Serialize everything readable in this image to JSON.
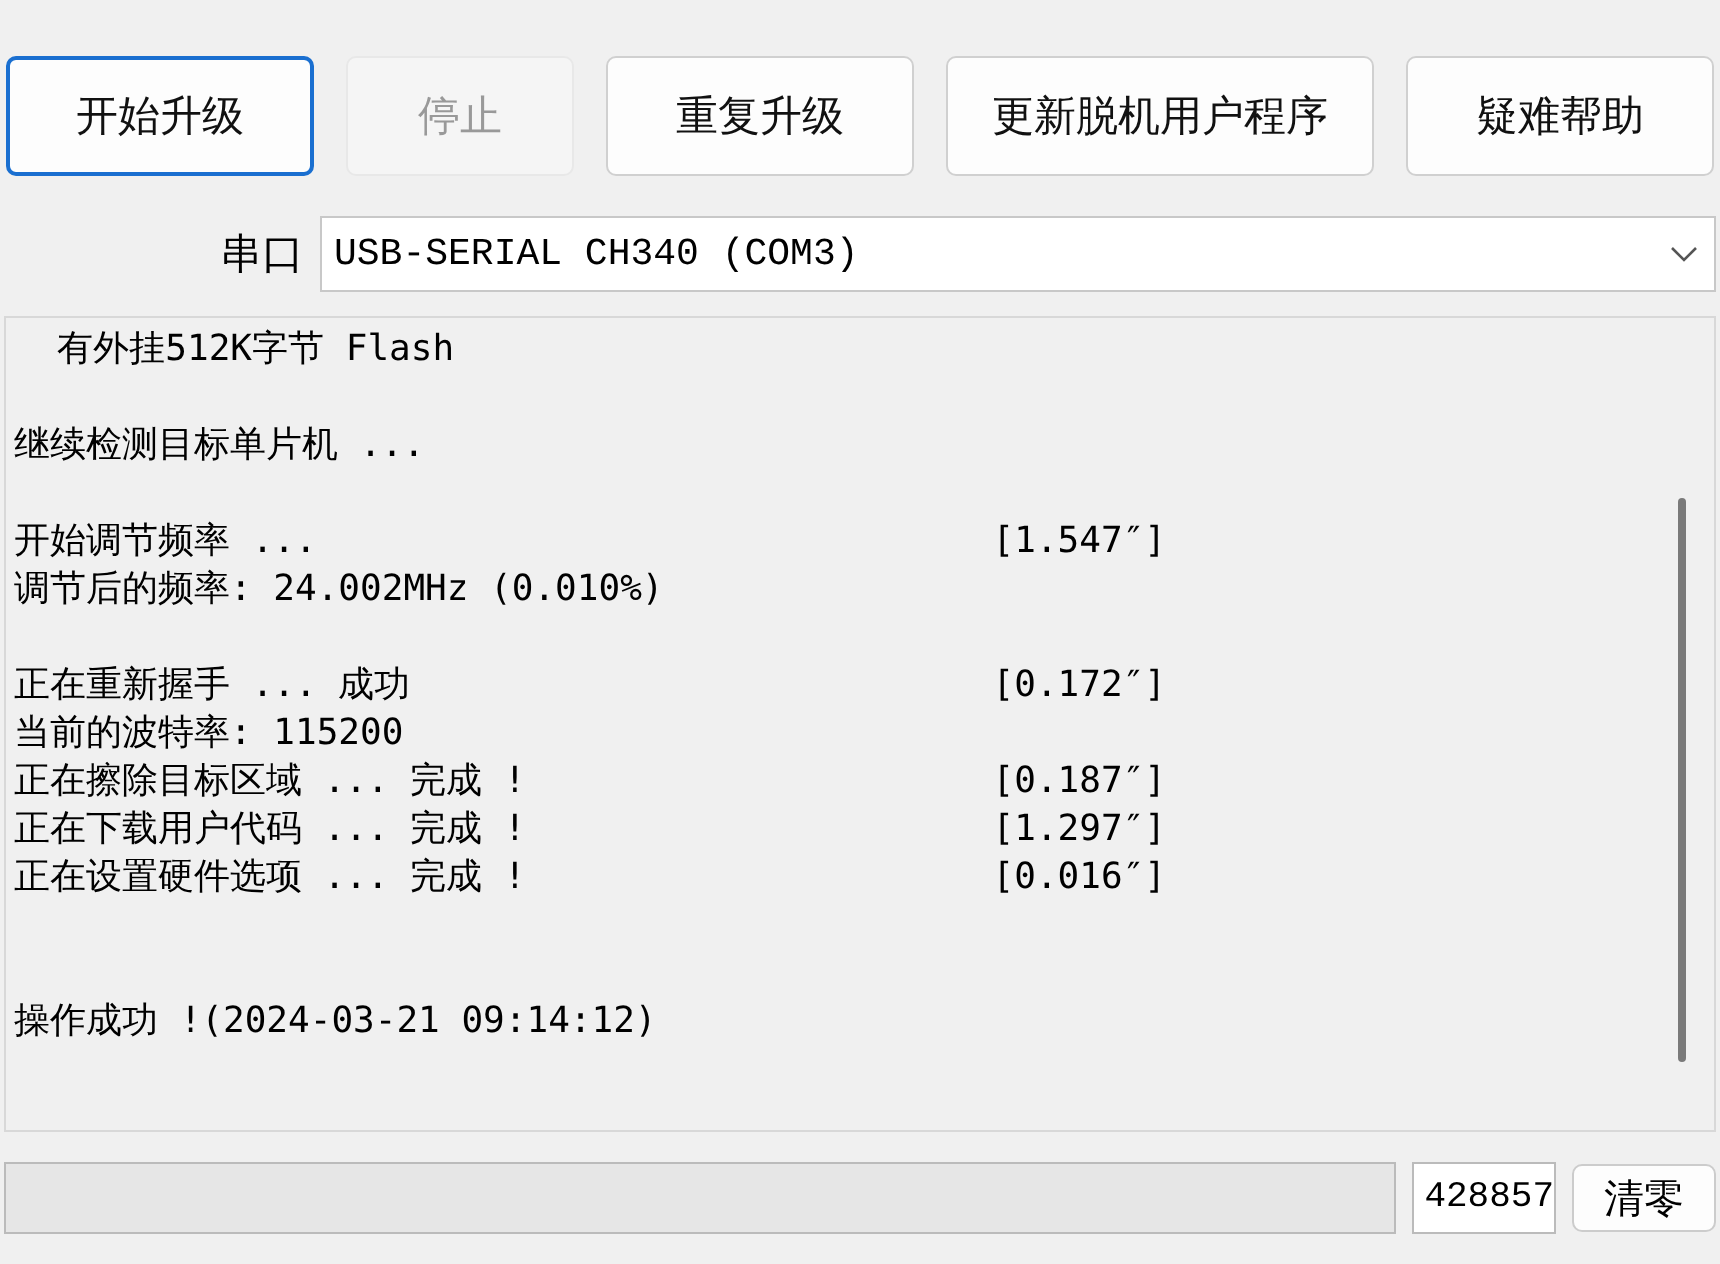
{
  "toolbar": [
    {
      "label": "开始升级",
      "kind": "focused"
    },
    {
      "label": "停止",
      "kind": "disabled"
    },
    {
      "label": "重复升级",
      "kind": "normal"
    },
    {
      "label": "更新脱机用户程序",
      "kind": "normal"
    },
    {
      "label": "疑难帮助",
      "kind": "normal"
    }
  ],
  "port": {
    "label": "串口",
    "value": "USB-SERIAL CH340 (COM3)"
  },
  "log": [
    {
      "kind": "step",
      "lines": [
        {
          "text": "  有外挂512K字节 Flash"
        }
      ]
    },
    {
      "kind": "step",
      "lines": [
        {
          "text": "继续检测目标单片机 ..."
        }
      ]
    },
    {
      "kind": "step",
      "lines": [
        {
          "text": "开始调节频率 ...",
          "time": "[1.547″]"
        },
        {
          "text": "调节后的频率: 24.002MHz (0.010%)"
        }
      ]
    },
    {
      "kind": "step",
      "lines": [
        {
          "text": "正在重新握手 ... 成功",
          "time": "[0.172″]"
        },
        {
          "text": "当前的波特率: 115200"
        },
        {
          "text": "正在擦除目标区域 ... 完成 !",
          "time": "[0.187″]"
        },
        {
          "text": "正在下载用户代码 ... 完成 !",
          "time": "[1.297″]"
        },
        {
          "text": "正在设置硬件选项 ... 完成 !",
          "time": "[0.016″]"
        }
      ]
    },
    {
      "kind": "result",
      "lines": [
        {
          "text": "操作成功 !(2024-03-21 09:14:12)"
        }
      ]
    }
  ],
  "status": {
    "progress": {
      "level": 0
    },
    "counter": "428857",
    "clear_button": "清零"
  }
}
